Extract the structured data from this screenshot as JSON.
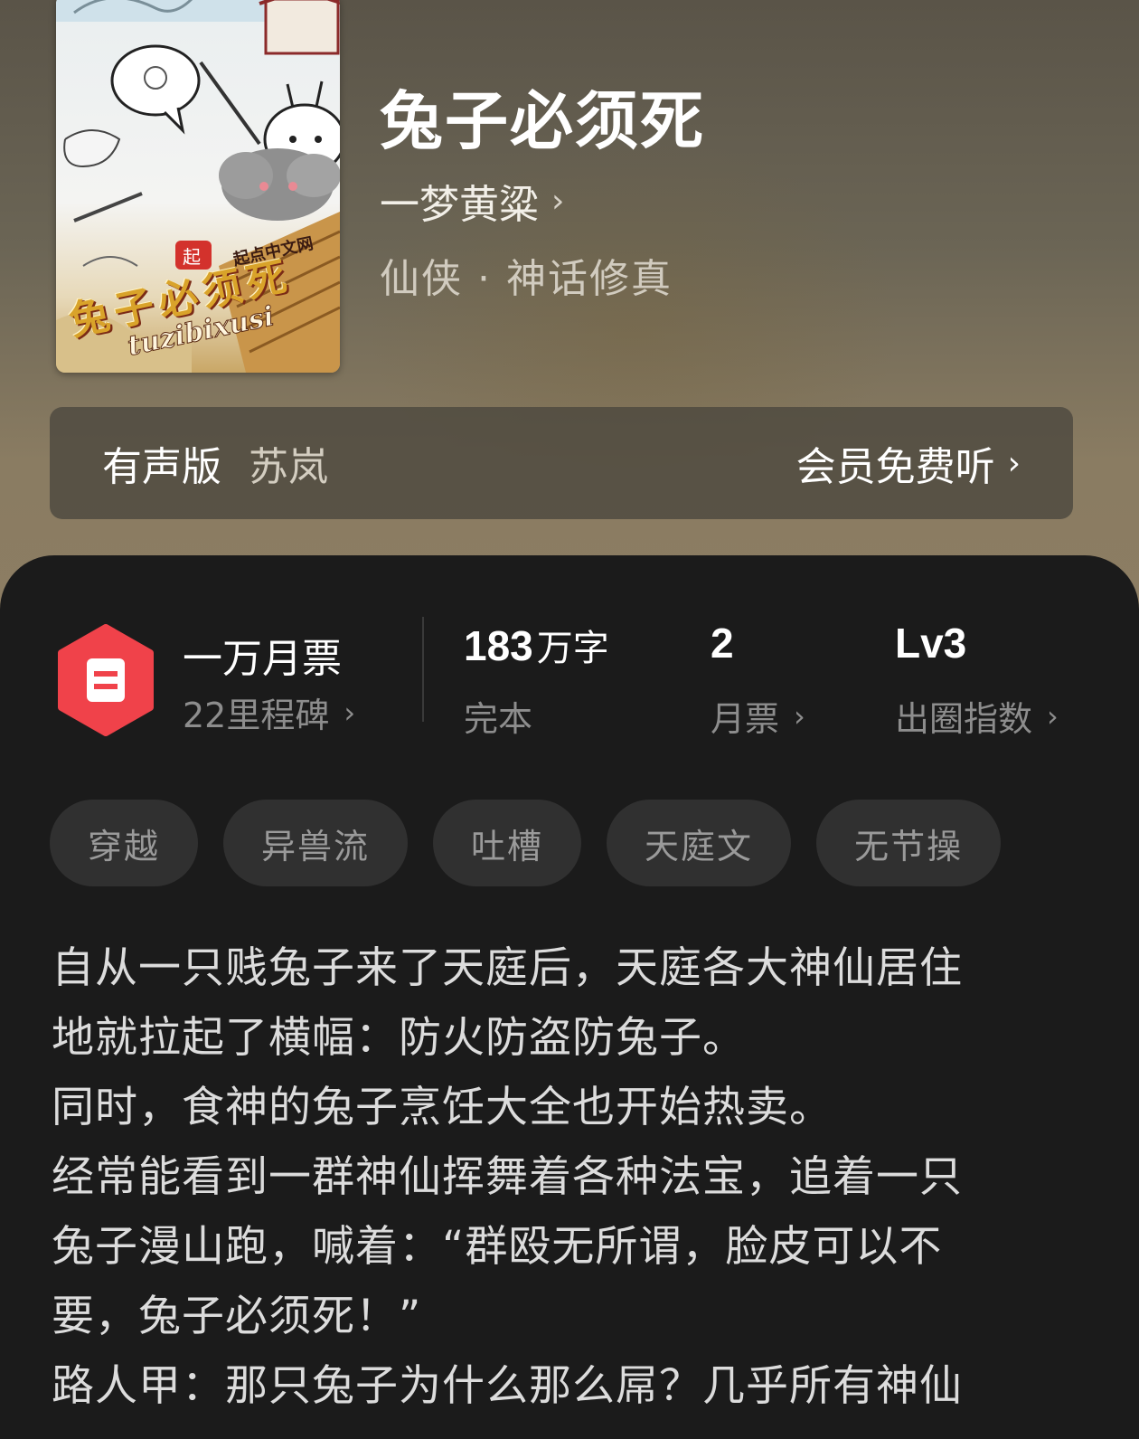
{
  "book": {
    "title": "兔子必须死",
    "author": "一梦黄粱",
    "genre": "仙侠 · 神话修真",
    "cover": {
      "brand_text": "起点中文网",
      "title_text": "兔子必须死",
      "pinyin_text": "tuzibixusi"
    }
  },
  "audio": {
    "label": "有声版",
    "narrator": "苏岚",
    "cta": "会员免费听"
  },
  "stats": {
    "milestone": {
      "title": "一万月票",
      "subtitle": "22里程碑"
    },
    "words": {
      "value": "183",
      "unit": "万字",
      "label": "完本"
    },
    "monthly_votes": {
      "value": "2",
      "label": "月票"
    },
    "popularity": {
      "value": "Lv3",
      "label": "出圈指数"
    }
  },
  "tags": [
    "穿越",
    "异兽流",
    "吐槽",
    "天庭文",
    "无节操"
  ],
  "description": [
    "自从一只贱兔子来了天庭后，天庭各大神仙居住",
    "地就拉起了横幅：防火防盗防兔子。",
    "同时，食神的兔子烹饪大全也开始热卖。",
    "经常能看到一群神仙挥舞着各种法宝，追着一只",
    "兔子漫山跑，喊着：“群殴无所谓，脸皮可以不",
    "要，兔子必须死！”",
    "路人甲：那只兔子为什么那么屌？几乎所有神仙"
  ],
  "colors": {
    "panel_bg": "#1b1b1b",
    "badge_red": "#f0424a",
    "tag_bg": "#303030"
  },
  "icons": {
    "chevron": "chevron-right-icon",
    "badge": "ticket-badge-icon"
  }
}
